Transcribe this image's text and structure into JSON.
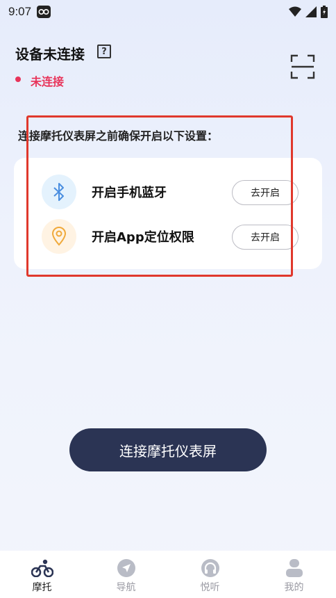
{
  "status_bar": {
    "time": "9:07"
  },
  "header": {
    "title": "设备未连接",
    "help_icon_text": "?"
  },
  "connection": {
    "status": "未连接",
    "status_color": "#e8345a"
  },
  "instructions": "连接摩托仪表屏之前确保开启以下设置：",
  "requirements": [
    {
      "icon": "bluetooth-icon",
      "label": "开启手机蓝牙",
      "button": "去开启",
      "accent": "#4a8ee0"
    },
    {
      "icon": "location-pin-icon",
      "label": "开启App定位权限",
      "button": "去开启",
      "accent": "#f0a93a"
    }
  ],
  "primary_action": {
    "label": "连接摩托仪表屏",
    "color": "#2b3454"
  },
  "highlight_color": "#e0382c",
  "bottom_nav": [
    {
      "label": "摩托",
      "icon": "motorcycle-icon",
      "active": true
    },
    {
      "label": "导航",
      "icon": "navigation-icon",
      "active": false
    },
    {
      "label": "悦听",
      "icon": "headphones-icon",
      "active": false
    },
    {
      "label": "我的",
      "icon": "profile-icon",
      "active": false
    }
  ]
}
